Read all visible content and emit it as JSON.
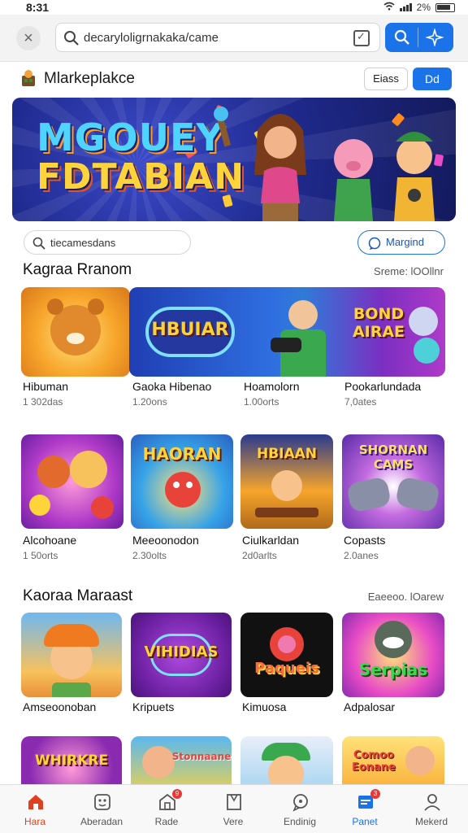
{
  "status": {
    "time": "8:31",
    "signal": "📶",
    "battery_pct": "2%"
  },
  "browser": {
    "url": "decaryloligrnakaka/came"
  },
  "app": {
    "title": "Mlarkeplakce",
    "ghost_button": "Eiass",
    "primary_button": "Dd"
  },
  "hero": {
    "line1": "MGOUEY",
    "line2": "FDTABIAN"
  },
  "search": {
    "placeholder": "tiecamesdans",
    "outline_button": "Margind"
  },
  "section1": {
    "title": "Kagraa Rranom",
    "link": "Sreme: lOOllnr",
    "row1": [
      {
        "name": "Hibuman",
        "sub": "1 302das"
      },
      {
        "name": "Gaoka Hibenao",
        "sub": "1.20ons",
        "banner_text": "HBUIAR"
      },
      {
        "name": "Hoamolorn",
        "sub": "1.00orts"
      },
      {
        "name": "Pookarlundada",
        "sub": "7,0ates",
        "banner_text": "BOND AIRAE"
      }
    ],
    "row2": [
      {
        "name": "Alcohoane",
        "sub": "1 50orts"
      },
      {
        "name": "Meeoonodon",
        "sub": "2.30olts",
        "banner_text": "HAORAN"
      },
      {
        "name": "Ciulkarldan",
        "sub": "2d0arlts",
        "banner_text": "HBIAAN"
      },
      {
        "name": "Copasts",
        "sub": "2.0anes",
        "banner_text": "SHORNAN CAMS"
      }
    ]
  },
  "section2": {
    "title": "Kaoraa Maraast",
    "link": "Eaeeoo. lOarew",
    "row1": [
      {
        "name": "Amseoonoban"
      },
      {
        "name": "Kripuets",
        "banner_text": "VIHIDIAS"
      },
      {
        "name": "Kimuosa",
        "banner_text": "Paqueis"
      },
      {
        "name": "Adpalosar",
        "banner_text": "Serpias"
      }
    ],
    "row2": [
      {
        "banner_text": "WHIRKRE"
      },
      {
        "banner_text": "Stonnaane"
      },
      {
        "banner_text": ""
      },
      {
        "banner_text": "Comoo Eonane"
      }
    ]
  },
  "nav": [
    {
      "label": "Hara",
      "icon": "home-icon"
    },
    {
      "label": "Aberadan",
      "icon": "gamepad-icon"
    },
    {
      "label": "Rade",
      "icon": "store-icon",
      "badge": "9"
    },
    {
      "label": "Vere",
      "icon": "bookmark-icon"
    },
    {
      "label": "Endinig",
      "icon": "chat-icon"
    },
    {
      "label": "Panet",
      "icon": "card-icon",
      "badge": "3"
    },
    {
      "label": "Mekerd",
      "icon": "profile-icon"
    }
  ],
  "colors": {
    "accent": "#1a73e8",
    "active_nav": "#e0401e"
  }
}
